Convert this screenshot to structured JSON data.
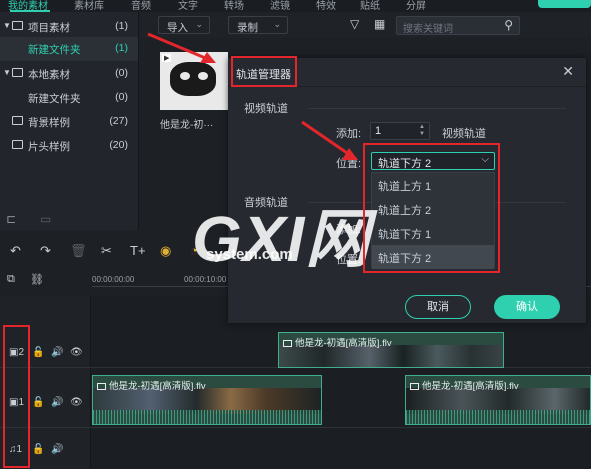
{
  "top_tabs": [
    "我的素材",
    "素材库",
    "音频",
    "文字",
    "转场",
    "滤镜",
    "特效",
    "贴纸",
    "分屏"
  ],
  "library": {
    "items": [
      {
        "label": "项目素材",
        "count": "(1)",
        "expandable": true
      },
      {
        "label": "新建文件夹",
        "count": "(1)",
        "selected": true
      },
      {
        "label": "本地素材",
        "count": "(0)",
        "expandable": true
      },
      {
        "label": "新建文件夹",
        "count": "(0)"
      },
      {
        "label": "背景样例",
        "count": "(27)"
      },
      {
        "label": "片头样例",
        "count": "(20)"
      }
    ]
  },
  "media_toolbar": {
    "import_label": "导入",
    "record_label": "录制",
    "search_placeholder": "搜索关键词"
  },
  "media": {
    "clip_label": "他是龙-初···"
  },
  "dialog": {
    "title": "轨道管理器",
    "video_section": "视频轨道",
    "add_label": "添加:",
    "add_value": "1",
    "add_unit": "视频轨道",
    "position_label": "位置:",
    "position_selected": "轨道下方 2",
    "position_options": [
      "轨道上方 1",
      "轨道上方 2",
      "轨道下方 1",
      "轨道下方 2"
    ],
    "audio_section": "音频轨道",
    "audio_add_label": "添加:",
    "audio_position_label": "位置:",
    "cancel_label": "取消",
    "ok_label": "确认"
  },
  "timeline": {
    "times": [
      "00:00:00:00",
      "00:00:10:00"
    ],
    "tracks": [
      {
        "label": "2",
        "type": "video"
      },
      {
        "label": "1",
        "type": "video"
      },
      {
        "label": "1",
        "type": "audio"
      }
    ],
    "clips": [
      "他是龙-初遇[高清版].flv",
      "他是龙-初遇[高清版].flv",
      "他是龙-初遇[高清版].flv"
    ]
  },
  "watermark": {
    "logo": "GXI网",
    "domain": "system.com"
  },
  "colors": {
    "accent": "#2fd0b0",
    "annotation_red": "#e2262c",
    "background": "#1d2025"
  }
}
